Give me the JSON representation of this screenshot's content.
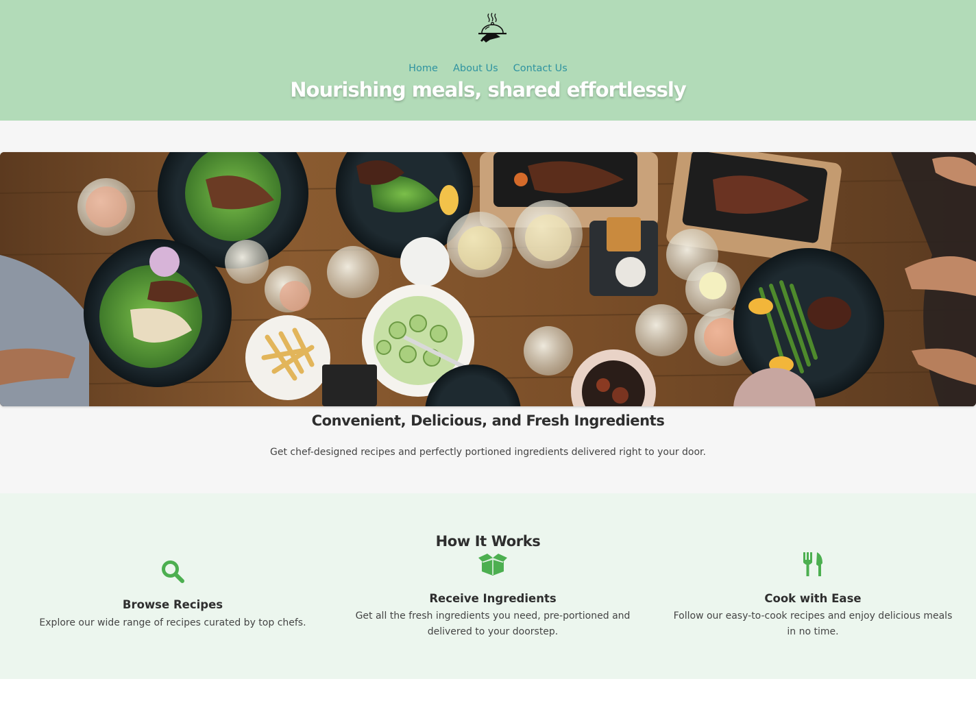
{
  "header": {
    "logo_icon": "serving-cloche-icon",
    "nav": [
      {
        "label": "Home"
      },
      {
        "label": "About Us"
      },
      {
        "label": "Contact Us"
      }
    ],
    "title": "Nourishing meals, shared effortlessly",
    "background": "#b2dbb8",
    "nav_color": "#2f93a0"
  },
  "intro": {
    "banner_image": "dining-table-food-photo",
    "heading": "Convenient, Delicious, and Fresh Ingredients",
    "text": "Get chef-designed recipes and perfectly portioned ingredients delivered right to your door."
  },
  "how_it_works": {
    "title": "How It Works",
    "accent": "#4caf50",
    "steps": [
      {
        "icon": "search-icon",
        "title": "Browse Recipes",
        "description": "Explore our wide range of recipes curated by top chefs."
      },
      {
        "icon": "box-icon",
        "title": "Receive Ingredients",
        "description": "Get all the fresh ingredients you need, pre-portioned and delivered to your doorstep."
      },
      {
        "icon": "utensils-icon",
        "title": "Cook with Ease",
        "description": "Follow our easy-to-cook recipes and enjoy delicious meals in no time."
      }
    ]
  }
}
